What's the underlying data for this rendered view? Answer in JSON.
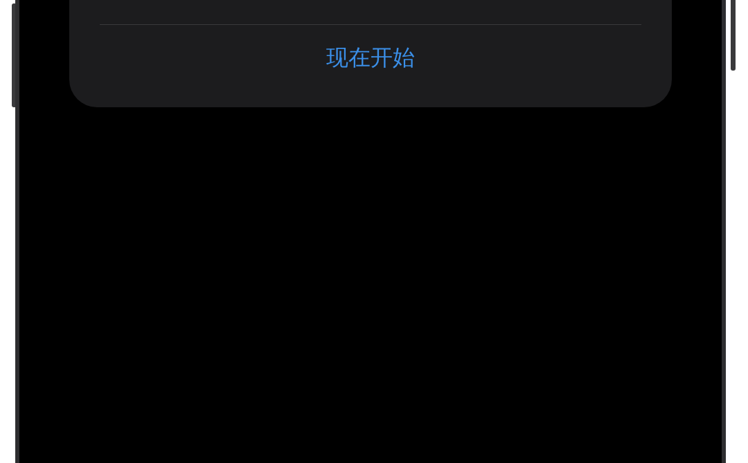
{
  "sheet": {
    "button": {
      "label": "现在开始"
    }
  }
}
